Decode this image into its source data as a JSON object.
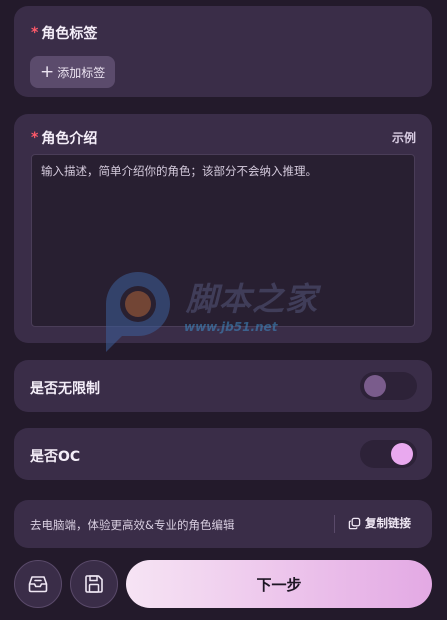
{
  "tags": {
    "required_mark": "*",
    "label": "角色标签",
    "add_button_label": "添加标签"
  },
  "intro": {
    "required_mark": "*",
    "label": "角色介绍",
    "example_link": "示例",
    "placeholder": "输入描述，简单介绍你的角色；该部分不会纳入推理。"
  },
  "watermark": {
    "text": "脚本之家",
    "url": "www.jb51.net"
  },
  "toggles": {
    "unlimited": {
      "label": "是否无限制",
      "on": false
    },
    "oc": {
      "label": "是否OC",
      "on": true
    }
  },
  "desktop": {
    "hint": "去电脑端，体验更高效&专业的角色编辑",
    "copy_link": "复制链接"
  },
  "footer": {
    "next_label": "下一步"
  },
  "icons": {
    "plus": "plus-icon",
    "copy": "copy-icon",
    "inbox": "inbox-icon",
    "save": "save-icon"
  },
  "colors": {
    "background": "#231a2b",
    "card": "#3a2d48",
    "required": "#ff5a6a",
    "switch_on_knob": "#e9a9ef",
    "switch_off_knob": "#7a5c8c",
    "next_gradient_start": "#f6e4f4",
    "next_gradient_end": "#e3a9e4"
  }
}
